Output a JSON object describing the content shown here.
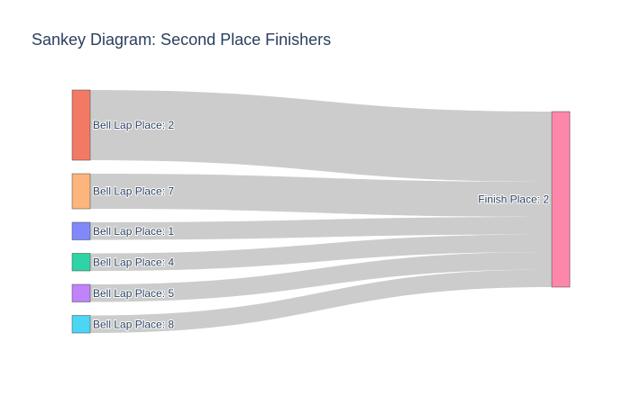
{
  "title": "Sankey Diagram: Second Place Finishers",
  "chart_data": {
    "type": "sankey",
    "nodes": [
      {
        "id": "bl2",
        "label": "Bell Lap Place: 2",
        "color": "#f27a64",
        "value": 20,
        "column": "source"
      },
      {
        "id": "bl7",
        "label": "Bell Lap Place: 7",
        "color": "#feb47d",
        "value": 10,
        "column": "source"
      },
      {
        "id": "bl1",
        "label": "Bell Lap Place: 1",
        "color": "#8088fb",
        "value": 5,
        "column": "source"
      },
      {
        "id": "bl4",
        "label": "Bell Lap Place: 4",
        "color": "#2fd4a6",
        "value": 5,
        "column": "source"
      },
      {
        "id": "bl5",
        "label": "Bell Lap Place: 5",
        "color": "#c083fa",
        "value": 5,
        "column": "source"
      },
      {
        "id": "bl8",
        "label": "Bell Lap Place: 8",
        "color": "#4bd6f5",
        "value": 5,
        "column": "source"
      },
      {
        "id": "fp2",
        "label": "Finish Place: 2",
        "color": "#fd87aa",
        "value": 50,
        "column": "target"
      }
    ],
    "links": [
      {
        "source": "bl2",
        "target": "fp2",
        "value": 20
      },
      {
        "source": "bl7",
        "target": "fp2",
        "value": 10
      },
      {
        "source": "bl1",
        "target": "fp2",
        "value": 5
      },
      {
        "source": "bl4",
        "target": "fp2",
        "value": 5
      },
      {
        "source": "bl5",
        "target": "fp2",
        "value": 5
      },
      {
        "source": "bl8",
        "target": "fp2",
        "value": 5
      }
    ],
    "link_color": "#cccccc"
  }
}
